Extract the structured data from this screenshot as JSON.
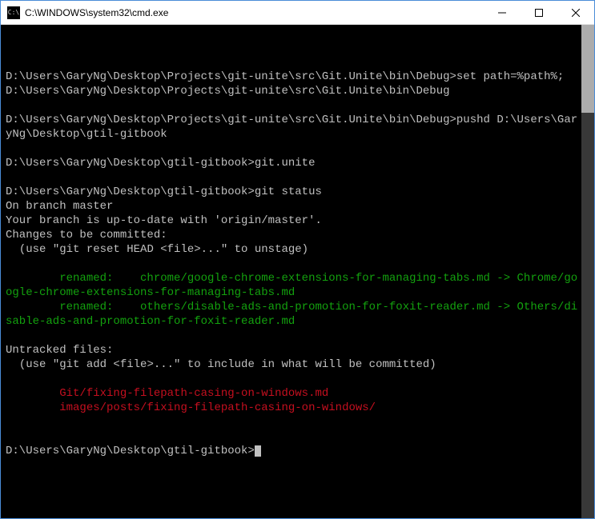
{
  "titlebar": {
    "icon_label": "C:\\",
    "title": "C:\\WINDOWS\\system32\\cmd.exe"
  },
  "terminal": {
    "blank": "",
    "line1_prompt": "D:\\Users\\GaryNg\\Desktop\\Projects\\git-unite\\src\\Git.Unite\\bin\\Debug>",
    "line1_cmd": "set path=%path%;D:\\Users\\GaryNg\\Desktop\\Projects\\git-unite\\src\\Git.Unite\\bin\\Debug",
    "line2_prompt": "D:\\Users\\GaryNg\\Desktop\\Projects\\git-unite\\src\\Git.Unite\\bin\\Debug>",
    "line2_cmd": "pushd D:\\Users\\GaryNg\\Desktop\\gtil-gitbook",
    "line3_prompt": "D:\\Users\\GaryNg\\Desktop\\gtil-gitbook>",
    "line3_cmd": "git.unite",
    "line4_prompt": "D:\\Users\\GaryNg\\Desktop\\gtil-gitbook>",
    "line4_cmd": "git status",
    "status_branch": "On branch master",
    "status_uptodate": "Your branch is up-to-date with 'origin/master'.",
    "status_changes": "Changes to be committed:",
    "status_unstage": "  (use \"git reset HEAD <file>...\" to unstage)",
    "renamed1": "        renamed:    chrome/google-chrome-extensions-for-managing-tabs.md -> Chrome/google-chrome-extensions-for-managing-tabs.md",
    "renamed2": "        renamed:    others/disable-ads-and-promotion-for-foxit-reader.md -> Others/disable-ads-and-promotion-for-foxit-reader.md",
    "untracked_header": "Untracked files:",
    "untracked_hint": "  (use \"git add <file>...\" to include in what will be committed)",
    "untracked1": "        Git/fixing-filepath-casing-on-windows.md",
    "untracked2": "        images/posts/fixing-filepath-casing-on-windows/",
    "final_prompt": "D:\\Users\\GaryNg\\Desktop\\gtil-gitbook>"
  }
}
